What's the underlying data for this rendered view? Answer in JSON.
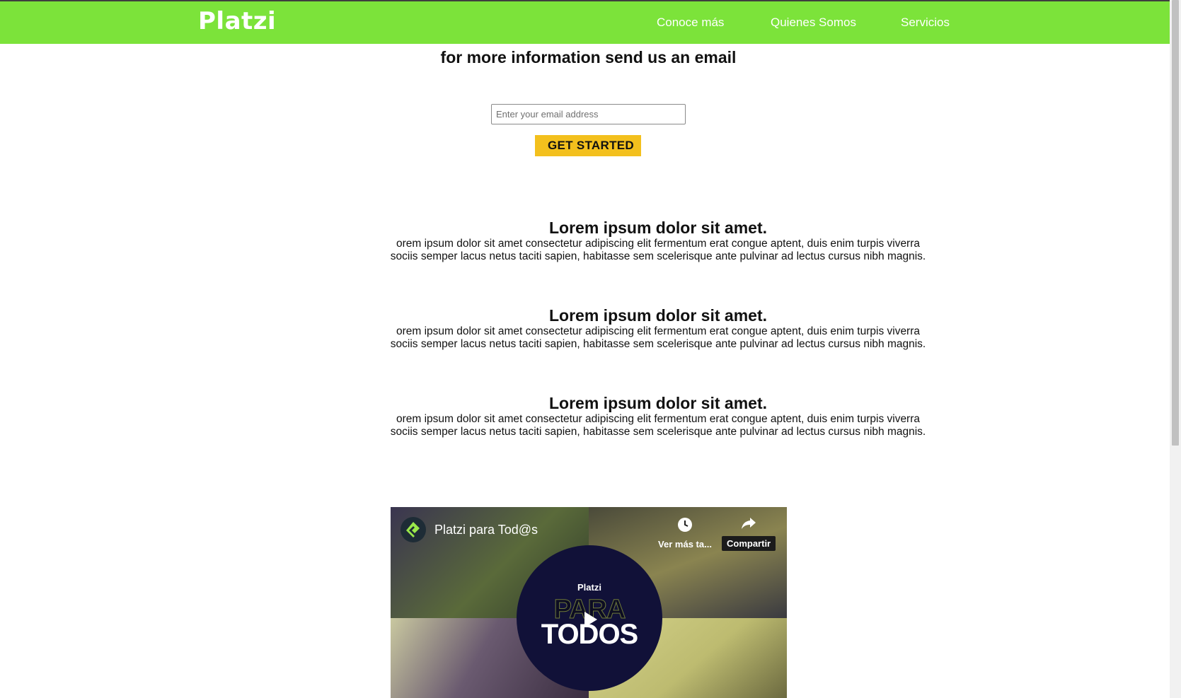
{
  "header": {
    "logo": "Platzi",
    "nav": [
      "Conoce más",
      "Quienes Somos",
      "Servicios"
    ],
    "bg_color": "#7ce33a"
  },
  "cta_section": {
    "heading": "for more information send us an email",
    "email_placeholder": "Enter your email address",
    "button_label": "GET STARTED",
    "button_color": "#f3c01d"
  },
  "items": [
    {
      "title": "Lorem ipsum dolor sit amet.",
      "line1": "orem ipsum dolor sit amet consectetur adipiscing elit fermentum erat congue aptent, duis enim turpis viverra",
      "line2": "sociis semper lacus netus taciti sapien, habitasse sem scelerisque ante pulvinar ad lectus cursus nibh magnis."
    },
    {
      "title": "Lorem ipsum dolor sit amet.",
      "line1": "orem ipsum dolor sit amet consectetur adipiscing elit fermentum erat congue aptent, duis enim turpis viverra",
      "line2": "sociis semper lacus netus taciti sapien, habitasse sem scelerisque ante pulvinar ad lectus cursus nibh magnis."
    },
    {
      "title": "Lorem ipsum dolor sit amet.",
      "line1": "orem ipsum dolor sit amet consectetur adipiscing elit fermentum erat congue aptent, duis enim turpis viverra",
      "line2": "sociis semper lacus netus taciti sapien, habitasse sem scelerisque ante pulvinar ad lectus cursus nibh magnis."
    }
  ],
  "video": {
    "title": "Platzi para Tod@s",
    "watch_later_label": "Ver más ta...",
    "share_label": "Compartir",
    "brand": "Platzi",
    "thumb_line1": "PARA",
    "thumb_line2": "TODOS",
    "icons": [
      "platzi-logo-icon",
      "clock-icon",
      "share-arrow-icon",
      "play-icon"
    ]
  }
}
